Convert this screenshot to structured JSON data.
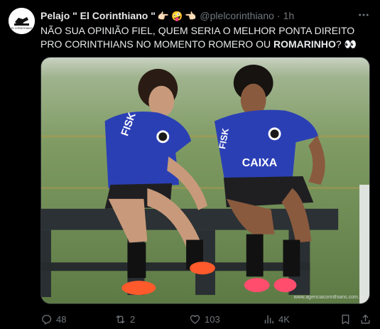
{
  "author": {
    "display_name": "Pelajo \" El Corinthiano \"",
    "emojis": [
      "👉🏻",
      "🤪",
      "👈🏻"
    ],
    "handle": "@plelcorinthiano",
    "separator": "·",
    "time": "1h",
    "avatar_icon": "corinthians-badge-icon"
  },
  "tweet": {
    "text_part1": "NÃO SUA OPINIÃO FIEL, QUEM SERIA O MELHOR PONTA DIREITO PRO CORINTHIANS NO MOMENTO ROMERO OU ",
    "text_bold": "ROMARINHO",
    "text_part2": "? 👀"
  },
  "media": {
    "alt": "Two Corinthians players sitting on a bench",
    "watermark": "www.agenciacorinthians.com.br",
    "jersey_sponsor": "CAIXA",
    "jersey_brand": "FISK"
  },
  "actions": {
    "replies": "48",
    "retweets": "2",
    "likes": "103",
    "views": "4K"
  },
  "colors": {
    "background": "#000000",
    "text": "#e7e9ea",
    "muted": "#71767b",
    "jersey": "#2b3fb5"
  }
}
